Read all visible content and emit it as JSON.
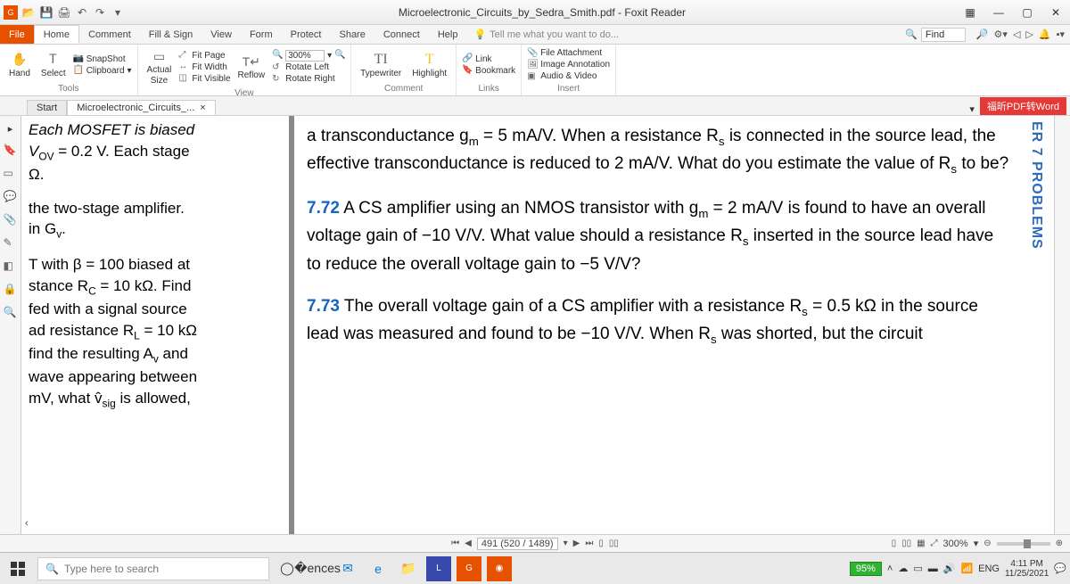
{
  "window": {
    "title": "Microelectronic_Circuits_by_Sedra_Smith.pdf - Foxit Reader"
  },
  "menu": {
    "file": "File",
    "tabs": [
      "Home",
      "Comment",
      "Fill & Sign",
      "View",
      "Form",
      "Protect",
      "Share",
      "Connect",
      "Help"
    ],
    "tell": "Tell me what you want to do...",
    "find": "Find"
  },
  "ribbon": {
    "tools": {
      "name": "Tools",
      "hand": "Hand",
      "select": "Select",
      "snapshot": "SnapShot",
      "clipboard": "Clipboard"
    },
    "view": {
      "name": "View",
      "actual": "Actual",
      "size": "Size",
      "fitpage": "Fit Page",
      "fitwidth": "Fit Width",
      "fitvisible": "Fit Visible",
      "reflow": "Reflow",
      "zoom": "300%",
      "rotleft": "Rotate Left",
      "rotright": "Rotate Right"
    },
    "comment": {
      "name": "Comment",
      "typewriter": "Typewriter",
      "highlight": "Highlight"
    },
    "links": {
      "name": "Links",
      "link": "Link",
      "bookmark": "Bookmark"
    },
    "insert": {
      "name": "Insert",
      "fileatt": "File Attachment",
      "imganno": "Image Annotation",
      "av": "Audio & Video"
    }
  },
  "doctabs": {
    "start": "Start",
    "doc": "Microelectronic_Circuits_...",
    "pdf2word": "福昕PDF转Word"
  },
  "leftpage": {
    "l1": "Each MOSFET is biased",
    "l2a": "V",
    "l2b": " = 0.2 V. Each stage",
    "l2sub": "OV",
    "l3": "Ω.",
    "l4": "the two-stage amplifier.",
    "l5": "in G",
    "l5sub": "v",
    "l5end": ".",
    "l6": "T with β = 100 biased at",
    "l7": "stance R",
    "l7sub": "C",
    "l7b": " = 10 kΩ. Find",
    "l8": "fed with a signal source",
    "l9": "ad resistance R",
    "l9sub": "L",
    "l9b": " = 10 kΩ",
    "l10": "find the resulting A",
    "l10sub": "v",
    "l10b": " and",
    "l11": "wave appearing between",
    "l12": "mV, what v̂",
    "l12sub": "sig",
    "l12b": " is allowed,"
  },
  "rightpage": {
    "p1a": "a transconductance g",
    "p1sub": "m",
    "p1b": " = 5 mA/V. When a resistance R",
    "p1sub2": "s",
    "p1c": " is connected in the source lead, the effective transconductance is reduced to 2 mA/V. What do you estimate the value of R",
    "p1sub3": "s",
    "p1d": " to be?",
    "p2num": "7.72",
    "p2a": " A CS amplifier using an NMOS transistor with g",
    "p2sub": "m",
    "p2b": " = 2 mA/V is found to have an overall voltage gain of −10 V/V. What value should a resistance R",
    "p2sub2": "s",
    "p2c": " inserted in the source lead have to reduce the overall voltage gain to −5 V/V?",
    "p3num": "7.73",
    "p3a": " The overall voltage gain of a CS amplifier with a resistance R",
    "p3sub": "s",
    "p3b": " = 0.5 kΩ in the source lead was measured and found to be −10 V/V. When R",
    "p3sub2": "s",
    "p3c": " was shorted, but the circuit",
    "sidetext": "ER 7  PROBLEMS"
  },
  "pagenav": {
    "pages": "491 (520 / 1489)",
    "zoom": "300%"
  },
  "taskbar": {
    "search": "Type here to search",
    "battery": "95%",
    "lang": "ENG",
    "time": "4:11 PM",
    "date": "11/25/2021"
  }
}
